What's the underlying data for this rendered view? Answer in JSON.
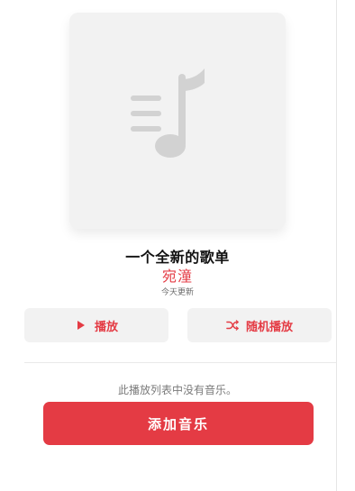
{
  "playlist": {
    "title": "一个全新的歌单",
    "author": "宛潼",
    "updated": "今天更新"
  },
  "actions": {
    "play_label": "播放",
    "shuffle_label": "随机播放"
  },
  "empty_state": {
    "message": "此播放列表中没有音乐。",
    "add_music_label": "添加音乐"
  },
  "icons": {
    "play": "play-icon",
    "shuffle": "shuffle-icon",
    "artwork": "music-note-icon"
  },
  "colors": {
    "accent": "#e43b44",
    "artwork_bg": "#f2f2f2",
    "button_bg": "#f2f2f2"
  }
}
